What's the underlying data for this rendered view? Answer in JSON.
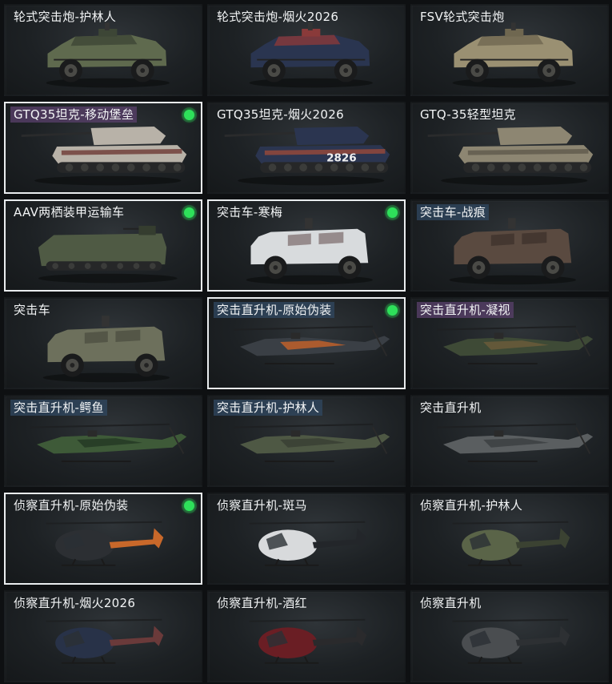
{
  "vehicles": [
    {
      "label": "轮式突击炮-护林人",
      "kind": "car",
      "tag": "none",
      "selected": false,
      "equipped": false,
      "c1": "#5f6a4e",
      "c2": "#3d4636"
    },
    {
      "label": "轮式突击炮-烟火2026",
      "kind": "car",
      "tag": "none",
      "selected": false,
      "equipped": false,
      "c1": "#2a3550",
      "c2": "#8a3a3a"
    },
    {
      "label": "FSV轮式突击炮",
      "kind": "car",
      "tag": "none",
      "selected": false,
      "equipped": false,
      "c1": "#9a9072",
      "c2": "#6f6750"
    },
    {
      "label": "GTQ35坦克-移动堡垒",
      "kind": "tank",
      "tag": "purple",
      "selected": true,
      "equipped": true,
      "c1": "#b8b2a8",
      "c2": "#6e3a34"
    },
    {
      "label": "GTQ35坦克-烟火2026",
      "kind": "tank",
      "tag": "none",
      "selected": false,
      "equipped": false,
      "c1": "#2b3550",
      "c2": "#9a4a3a",
      "badge": "2826"
    },
    {
      "label": "GTQ-35轻型坦克",
      "kind": "tank",
      "tag": "none",
      "selected": false,
      "equipped": false,
      "c1": "#8d8672",
      "c2": "#5f5a4c"
    },
    {
      "label": "AAV两栖装甲运输车",
      "kind": "aav",
      "tag": "none",
      "selected": true,
      "equipped": true,
      "c1": "#4f5a44",
      "c2": "#353d2f"
    },
    {
      "label": "突击车-寒梅",
      "kind": "truck",
      "tag": "none",
      "selected": true,
      "equipped": true,
      "c1": "#d8dbdd",
      "c2": "#7a6a6a"
    },
    {
      "label": "突击车-战痕",
      "kind": "truck",
      "tag": "blue",
      "selected": false,
      "equipped": false,
      "c1": "#5a4a40",
      "c2": "#3a2f2a"
    },
    {
      "label": "突击车",
      "kind": "truck",
      "tag": "none",
      "selected": false,
      "equipped": false,
      "c1": "#6d705c",
      "c2": "#4a4c3e"
    },
    {
      "label": "突击直升机-原始伪装",
      "kind": "heli",
      "tag": "blue",
      "selected": true,
      "equipped": true,
      "c1": "#3a3f45",
      "c2": "#c0602a"
    },
    {
      "label": "突击直升机-凝视",
      "kind": "heli",
      "tag": "purple",
      "selected": false,
      "equipped": false,
      "c1": "#3e4a36",
      "c2": "#6a5a3a"
    },
    {
      "label": "突击直升机-鳄鱼",
      "kind": "heli",
      "tag": "blue",
      "selected": false,
      "equipped": false,
      "c1": "#3e5a38",
      "c2": "#253a24"
    },
    {
      "label": "突击直升机-护林人",
      "kind": "heli",
      "tag": "blue",
      "selected": false,
      "equipped": false,
      "c1": "#4e5844",
      "c2": "#3a4034"
    },
    {
      "label": "突击直升机",
      "kind": "heli",
      "tag": "none",
      "selected": false,
      "equipped": false,
      "c1": "#5a5e60",
      "c2": "#3c4042"
    },
    {
      "label": "侦察直升机-原始伪装",
      "kind": "scout",
      "tag": "none",
      "selected": true,
      "equipped": true,
      "c1": "#2c2f33",
      "c2": "#c8682a"
    },
    {
      "label": "侦察直升机-斑马",
      "kind": "scout",
      "tag": "none",
      "selected": false,
      "equipped": false,
      "c1": "#d8dadc",
      "c2": "#23262a"
    },
    {
      "label": "侦察直升机-护林人",
      "kind": "scout",
      "tag": "none",
      "selected": false,
      "equipped": false,
      "c1": "#5a6448",
      "c2": "#3b4232"
    },
    {
      "label": "侦察直升机-烟火2026",
      "kind": "scout",
      "tag": "none",
      "selected": false,
      "equipped": false,
      "c1": "#283248",
      "c2": "#6a3a3a"
    },
    {
      "label": "侦察直升机-酒红",
      "kind": "scout",
      "tag": "none",
      "selected": false,
      "equipped": false,
      "c1": "#6a1e24",
      "c2": "#2a2a2c"
    },
    {
      "label": "侦察直升机",
      "kind": "scout",
      "tag": "none",
      "selected": false,
      "equipped": false,
      "c1": "#4a4d50",
      "c2": "#2d3033"
    }
  ]
}
